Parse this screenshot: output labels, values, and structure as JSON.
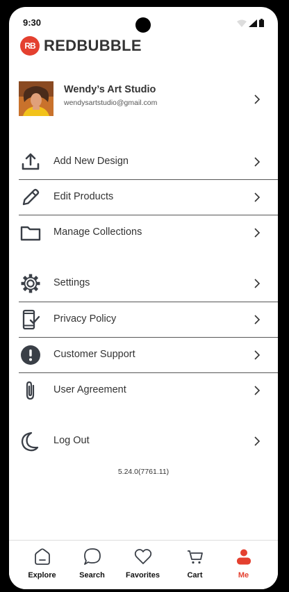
{
  "status_bar": {
    "time": "9:30"
  },
  "brand": {
    "badge": "RB",
    "name": "REDBUBBLE",
    "color": "#e4402f"
  },
  "profile": {
    "name": "Wendy’s Art Studio",
    "email": "wendysartstudio@gmail.com"
  },
  "menu_group_1": [
    {
      "label": "Add New Design",
      "icon": "upload-icon"
    },
    {
      "label": "Edit Products",
      "icon": "pencil-icon"
    },
    {
      "label": "Manage Collections",
      "icon": "folder-icon"
    }
  ],
  "menu_group_2": [
    {
      "label": "Settings",
      "icon": "gear-icon"
    },
    {
      "label": "Privacy Policy",
      "icon": "phone-check-icon"
    },
    {
      "label": "Customer Support",
      "icon": "alert-icon"
    },
    {
      "label": "User Agreement",
      "icon": "paperclip-icon"
    }
  ],
  "logout": {
    "label": "Log Out",
    "icon": "moon-icon"
  },
  "version": "5.24.0(7761.11)",
  "tabs": [
    {
      "label": "Explore",
      "icon": "home-icon"
    },
    {
      "label": "Search",
      "icon": "chat-bubble-icon"
    },
    {
      "label": "Favorites",
      "icon": "heart-icon"
    },
    {
      "label": "Cart",
      "icon": "cart-icon"
    },
    {
      "label": "Me",
      "icon": "person-icon",
      "active": true
    }
  ]
}
